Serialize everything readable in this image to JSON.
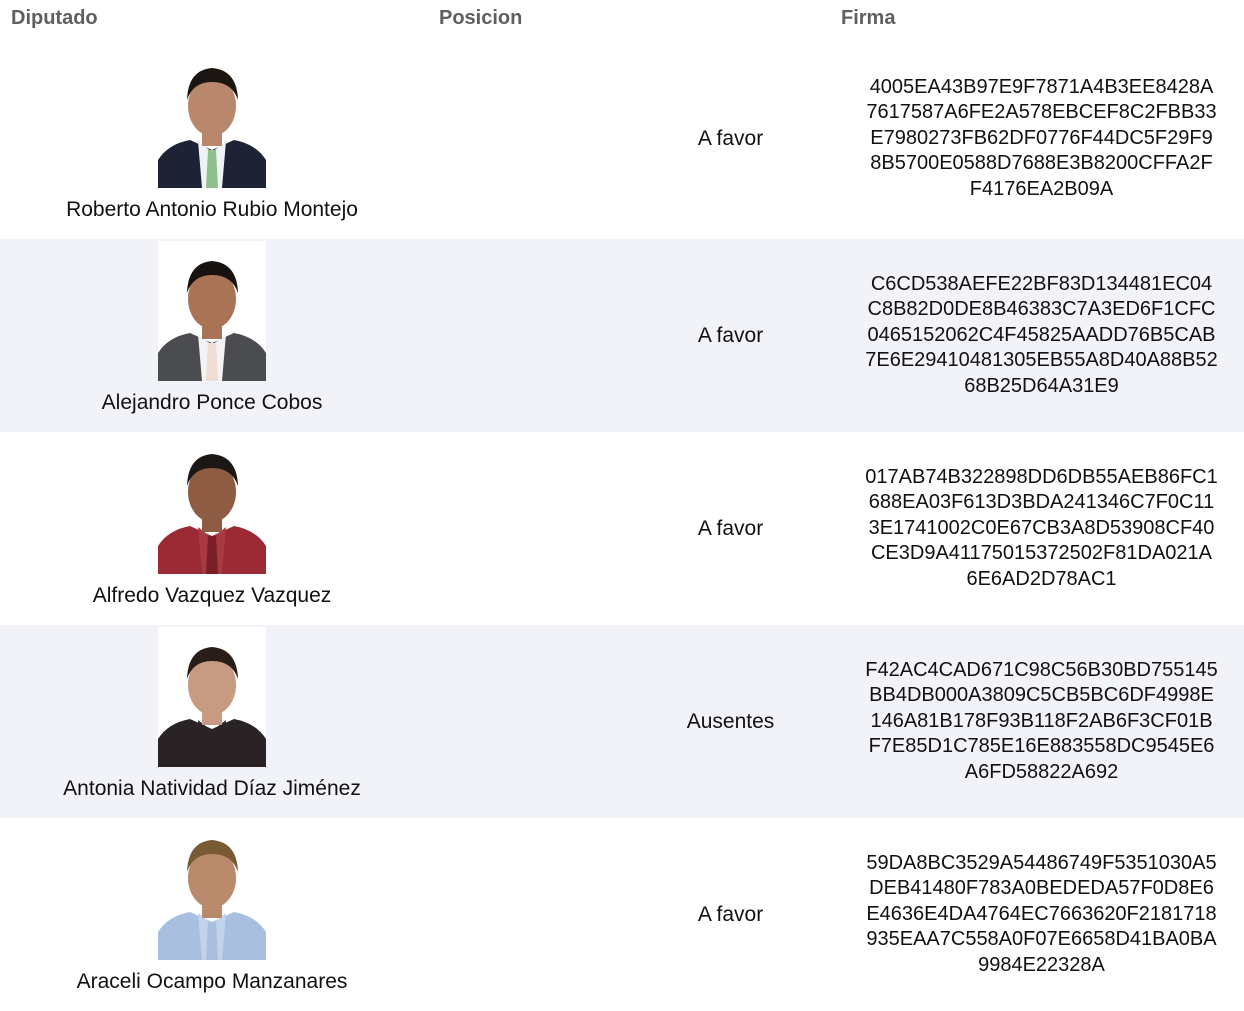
{
  "headers": {
    "diputado": "Diputado",
    "posicion": "Posicion",
    "firma": "Firma"
  },
  "rows": [
    {
      "name": "Roberto Antonio Rubio Montejo",
      "position": "A favor",
      "signature_lines": [
        "4005EA43B97E9F7871A4B3EE8428A",
        "7617587A6FE2A578EBCEF8C2FBB33",
        "E7980273FB62DF0776F44DC5F29F9",
        "8B5700E0588D7688E3B8200CFFA2F",
        "F4176EA2B09A"
      ],
      "photo": {
        "bg": "#ffffff",
        "hair": "#1c1612",
        "skin": "#b9876c",
        "suit": "#1e2235",
        "shirt": "#eef2f4",
        "tie": "#8fbf8a"
      }
    },
    {
      "name": "Alejandro Ponce Cobos",
      "position": "A favor",
      "signature_lines": [
        "C6CD538AEFE22BF83D134481EC04",
        "C8B82D0DE8B46383C7A3ED6F1CFC",
        "0465152062C4F45825AADD76B5CAB",
        "7E6E29410481305EB55A8D40A88B52",
        "68B25D64A31E9"
      ],
      "photo": {
        "bg": "#ffffff",
        "hair": "#15120f",
        "skin": "#a97356",
        "suit": "#4b4c50",
        "shirt": "#f3f3f3",
        "tie": "#f0dcd2"
      }
    },
    {
      "name": "Alfredo Vazquez Vazquez",
      "position": "A favor",
      "signature_lines": [
        "017AB74B322898DD6DB55AEB86FC1",
        "688EA03F613D3BDA241346C7F0C11",
        "3E1741002C0E67CB3A8D53908CF40",
        "CE3D9A41175015372502F81DA021A",
        "6E6AD2D78AC1"
      ],
      "photo": {
        "bg": "#ffffff",
        "hair": "#1a1714",
        "skin": "#8e5c42",
        "suit": "#9b2a35",
        "shirt": "#a73a43",
        "tie": "#7a1f28"
      }
    },
    {
      "name": "Antonia Natividad Díaz Jiménez",
      "position": "Ausentes",
      "signature_lines": [
        "F42AC4CAD671C98C56B30BD755145",
        "BB4DB000A3809C5CB5BC6DF4998E",
        "146A81B178F93B118F2AB6F3CF01B",
        "F7E85D1C785E16E883558DC9545E6",
        "A6FD58822A692"
      ],
      "photo": {
        "bg": "#ffffff",
        "hair": "#2a1d17",
        "skin": "#c79a82",
        "suit": "#2a2326",
        "shirt": "#2a2326",
        "tie": "#2a2326"
      }
    },
    {
      "name": "Araceli Ocampo Manzanares",
      "position": "A favor",
      "signature_lines": [
        "59DA8BC3529A54486749F5351030A5",
        "DEB41480F783A0BEDEDA57F0D8E6",
        "E4636E4DA4764EC7663620F2181718",
        "935EAA7C558A0F07E6658D41BA0BA",
        "9984E22328A"
      ],
      "photo": {
        "bg": "#ffffff",
        "hair": "#7a5a35",
        "skin": "#b98a6c",
        "suit": "#a8bfe0",
        "shirt": "#c3d3ec",
        "tie": "#a8bfe0"
      }
    }
  ]
}
